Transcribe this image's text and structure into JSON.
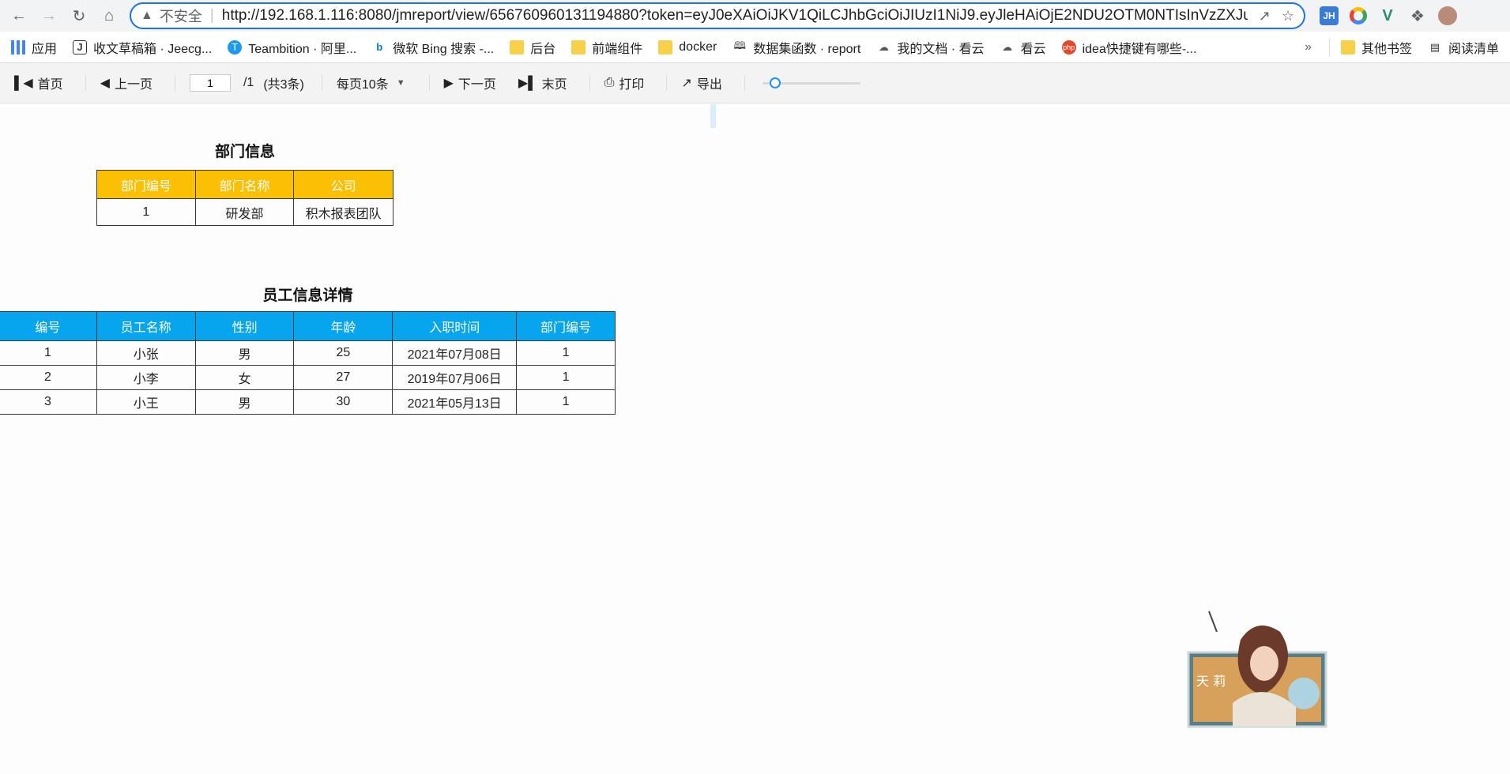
{
  "browser": {
    "insecure_label": "不安全",
    "url": "http://192.168.1.116:8080/jmreport/view/656760960131194880?token=eyJ0eXAiOiJKV1QiLCJhbGciOiJIUzI1NiJ9.eyJleHAiOjE2NDU2OTM0NTIsInVzZXJuYW",
    "extensions": [
      "JH",
      "chrome-ring",
      "V",
      "puzzle",
      "avatar"
    ]
  },
  "bookmarks": {
    "items": [
      {
        "icon": "apps-icon",
        "label": "应用"
      },
      {
        "icon": "jeecg-icon",
        "label": "收文草稿箱 · Jeecg..."
      },
      {
        "icon": "teambition-icon",
        "label": "Teambition · 阿里..."
      },
      {
        "icon": "bing-icon",
        "label": "微软 Bing 搜索 -..."
      },
      {
        "icon": "folder-icon",
        "label": "后台"
      },
      {
        "icon": "folder-icon",
        "label": "前端组件"
      },
      {
        "icon": "folder-icon",
        "label": "docker"
      },
      {
        "icon": "book-icon",
        "label": "数据集函数 · report"
      },
      {
        "icon": "cloud-icon",
        "label": "我的文档 · 看云"
      },
      {
        "icon": "cloud-icon",
        "label": "看云"
      },
      {
        "icon": "php-icon",
        "label": "idea快捷键有哪些-..."
      }
    ],
    "more": "»",
    "other_label": "其他书签",
    "reading_label": "阅读清单"
  },
  "toolbar": {
    "first_label": "首页",
    "prev_label": "上一页",
    "page_value": "1",
    "page_total": "/1",
    "record_count": "(共3条)",
    "page_size_label": "每页10条",
    "next_label": "下一页",
    "last_label": "末页",
    "print_label": "打印",
    "export_label": "导出",
    "zoom_level": 0.08
  },
  "dept_section": {
    "title": "部门信息",
    "headers": [
      "部门编号",
      "部门名称",
      "公司"
    ],
    "rows": [
      [
        "1",
        "研发部",
        "积木报表团队"
      ]
    ],
    "header_color": "#fbbf04"
  },
  "emp_section": {
    "title": "员工信息详情",
    "headers": [
      "编号",
      "员工名称",
      "性别",
      "年龄",
      "入职时间",
      "部门编号"
    ],
    "rows": [
      [
        "1",
        "小张",
        "男",
        "25",
        "2021年07月08日",
        "1"
      ],
      [
        "2",
        "小李",
        "女",
        "27",
        "2019年07月06日",
        "1"
      ],
      [
        "3",
        "小王",
        "男",
        "30",
        "2021年05月13日",
        "1"
      ]
    ],
    "header_color": "#06a5ed"
  },
  "mascot": {
    "caption": "天 莉"
  }
}
